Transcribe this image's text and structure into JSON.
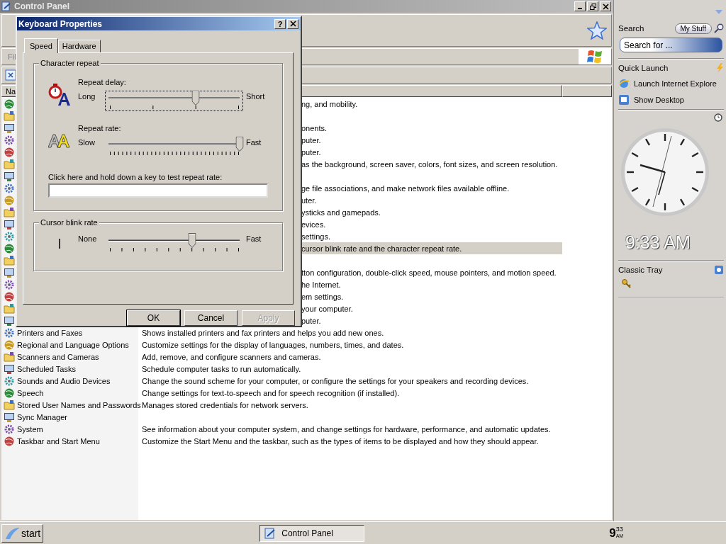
{
  "control_panel": {
    "title": "Control Panel",
    "menu": [
      "Fil"
    ],
    "column_header": "Na",
    "covered_rows": [
      {
        "desc": "ng, and mobility.",
        "selected": false
      },
      {
        "selected": false
      },
      {
        "desc": "onents.",
        "selected": false
      },
      {
        "desc": "puter.",
        "selected": false
      },
      {
        "desc": "puter.",
        "selected": false
      },
      {
        "desc": "as the background, screen saver, colors, font sizes, and screen resolution.",
        "selected": false
      },
      {
        "selected": false
      },
      {
        "desc": "ge file associations, and make network files available offline.",
        "selected": false
      },
      {
        "desc": "uter.",
        "selected": false
      },
      {
        "desc": "ysticks and gamepads.",
        "selected": false
      },
      {
        "desc": "evices.",
        "selected": false
      },
      {
        "desc": "settings.",
        "selected": false
      },
      {
        "desc": "cursor blink rate and the character repeat rate.",
        "selected": true
      },
      {
        "selected": false
      },
      {
        "desc": "tton configuration, double-click speed, mouse pointers, and motion speed.",
        "selected": false
      },
      {
        "desc": "he Internet.",
        "selected": false
      },
      {
        "desc": "em settings.",
        "selected": false
      },
      {
        "desc": "your computer.",
        "selected": false
      },
      {
        "desc": "puter.",
        "selected": false
      }
    ],
    "rows": [
      {
        "name": "Printers and Faxes",
        "desc": "Shows installed printers and fax printers and helps you add new ones.",
        "selected": false
      },
      {
        "name": "Regional and Language Options",
        "desc": "Customize settings for the display of languages, numbers, times, and dates.",
        "selected": false
      },
      {
        "name": "Scanners and Cameras",
        "desc": "Add, remove, and configure scanners and cameras.",
        "selected": false
      },
      {
        "name": "Scheduled Tasks",
        "desc": "Schedule computer tasks to run automatically.",
        "selected": false
      },
      {
        "name": "Sounds and Audio Devices",
        "desc": "Change the sound scheme for your computer, or configure the settings for your speakers and recording devices.",
        "selected": false
      },
      {
        "name": "Speech",
        "desc": "Change settings for text-to-speech and for speech recognition (if installed).",
        "selected": false
      },
      {
        "name": "Stored User Names and Passwords",
        "desc": "Manages stored credentials for network servers.",
        "selected": false
      },
      {
        "name": "Sync Manager",
        "selected": false
      },
      {
        "name": "System",
        "desc": "See information about your computer system, and change settings for hardware, performance, and automatic updates.",
        "selected": false
      },
      {
        "name": "Taskbar and Start Menu",
        "desc": "Customize the Start Menu and the taskbar, such as the types of items to be displayed and how they should appear.",
        "selected": false
      }
    ]
  },
  "dialog": {
    "title": "Keyboard Properties",
    "help": "?",
    "tabs": [
      {
        "label": "Speed",
        "selected": true
      },
      {
        "label": "Hardware",
        "selected": false
      }
    ],
    "groups": [
      {
        "title": "Character repeat",
        "settings": [
          {
            "kind": "delay",
            "label": "Repeat delay:",
            "min_label": "Long",
            "max_label": "Short",
            "level": 0.667,
            "focused": true
          },
          {
            "kind": "rate",
            "label": "Repeat rate:",
            "min_label": "Slow",
            "max_label": "Fast",
            "level": 1,
            "focused": false
          }
        ],
        "test_label": "Click here and hold down a key to test repeat rate:"
      },
      {
        "title": "Cursor blink rate",
        "settings": [
          {
            "kind": "blink",
            "min_label": "None",
            "max_label": "Fast",
            "level": 0.636,
            "focused": false
          }
        ]
      }
    ],
    "buttons": [
      {
        "label": "OK",
        "default": true,
        "disabled": false
      },
      {
        "label": "Cancel",
        "default": false,
        "disabled": false
      },
      {
        "label": "Apply",
        "default": false,
        "disabled": true
      }
    ]
  },
  "sidebar": {
    "search": {
      "title": "Search",
      "scope_button": "My Stuff",
      "placeholder": "Search for ..."
    },
    "quick_launch": {
      "title": "Quick Launch",
      "items": [
        {
          "label": "Launch Internet Explore",
          "kind": "browser"
        },
        {
          "label": "Show Desktop",
          "kind": "desktop"
        }
      ]
    },
    "clock": {
      "time": "9:33 AM"
    },
    "tray": {
      "title": "Classic Tray"
    }
  },
  "taskbar": {
    "start": "start",
    "tasks": [
      {
        "label": "Control Panel",
        "selected": true
      }
    ],
    "clock": {
      "hour": "9",
      "minutes": "33",
      "period": "AM"
    }
  }
}
